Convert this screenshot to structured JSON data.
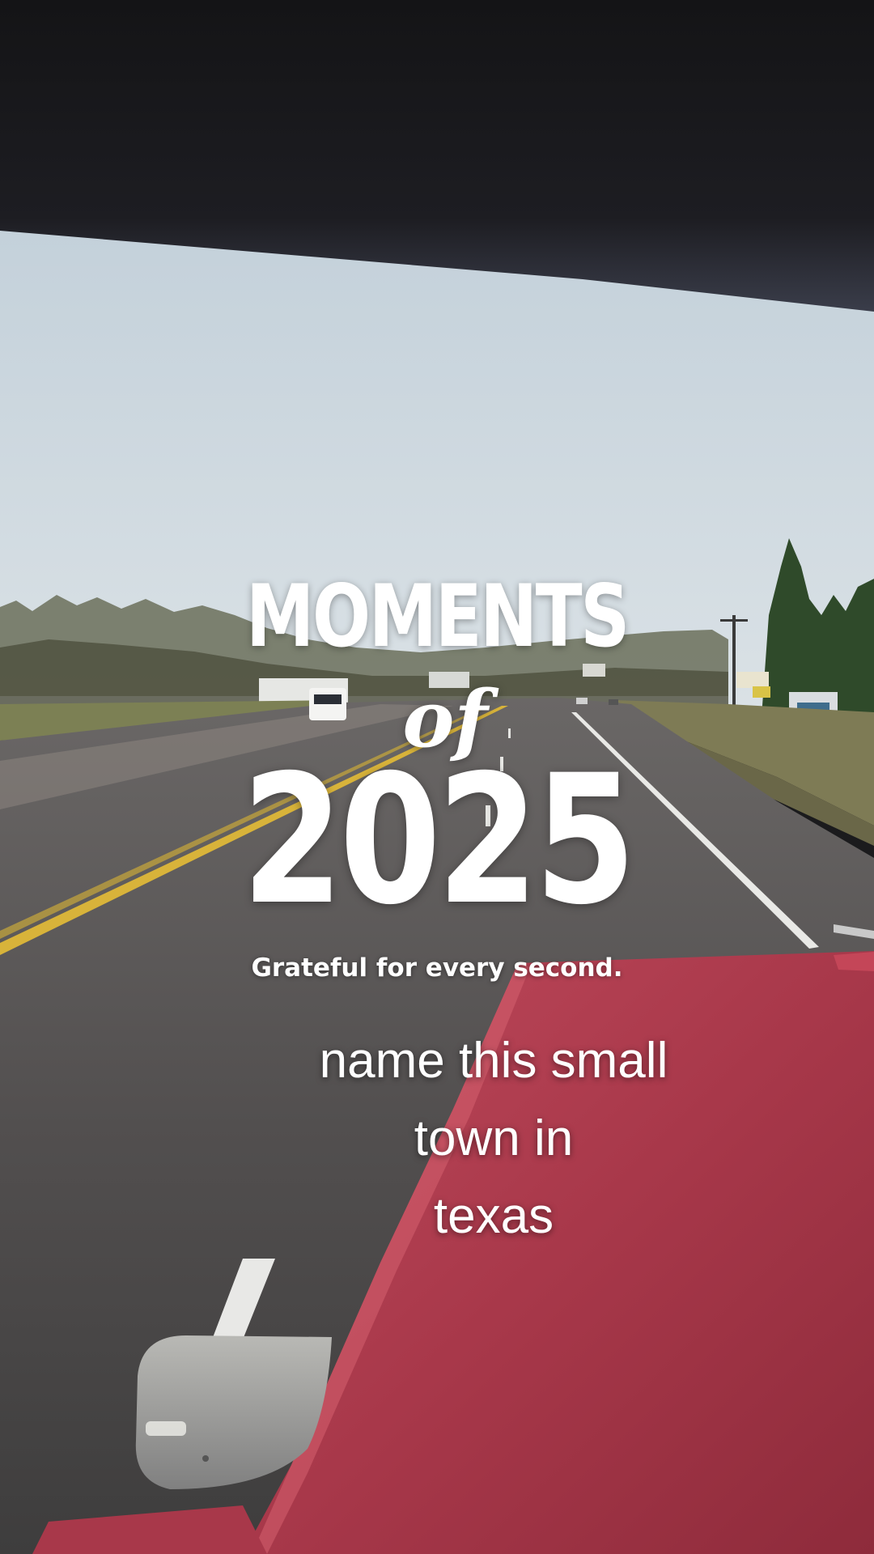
{
  "overlay": {
    "title_line1": "MOMENTS",
    "title_line2": "of",
    "title_year": "2025",
    "subtitle": "Grateful for every second."
  },
  "caption": {
    "lines": [
      "name this small",
      "town in",
      "texas"
    ]
  },
  "colors": {
    "sky_top": "#bccbd6",
    "sky_bottom": "#d7dfe4",
    "road": "#4f4f4f",
    "center_line": "#d8b33a",
    "grass": "#7c8054",
    "truck_hood": "#a83a4a",
    "dash_shade": "#17171a"
  }
}
